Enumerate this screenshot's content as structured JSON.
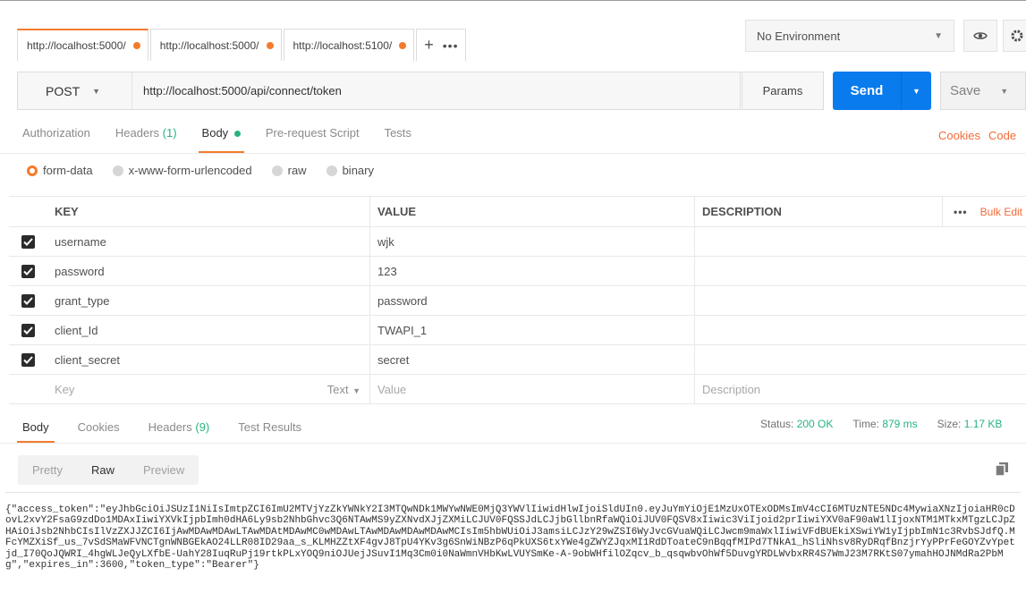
{
  "tabs": [
    {
      "label": "http://localhost:5000/"
    },
    {
      "label": "http://localhost:5000/"
    },
    {
      "label": "http://localhost:5100/"
    }
  ],
  "environment": {
    "selected": "No Environment"
  },
  "request": {
    "method": "POST",
    "url": "http://localhost:5000/api/connect/token",
    "params_label": "Params",
    "send_label": "Send",
    "save_label": "Save"
  },
  "request_tabs": {
    "authorization": "Authorization",
    "headers": "Headers",
    "headers_count": "(1)",
    "body": "Body",
    "prerequest": "Pre-request Script",
    "tests": "Tests",
    "cookies": "Cookies",
    "code": "Code"
  },
  "body_types": {
    "form_data": "form-data",
    "urlencoded": "x-www-form-urlencoded",
    "raw": "raw",
    "binary": "binary"
  },
  "table": {
    "headers": {
      "key": "KEY",
      "value": "VALUE",
      "description": "DESCRIPTION",
      "bulk_edit": "Bulk Edit"
    },
    "rows": [
      {
        "key": "username",
        "value": "wjk"
      },
      {
        "key": "password",
        "value": "123"
      },
      {
        "key": "grant_type",
        "value": "password"
      },
      {
        "key": "client_Id",
        "value": "TWAPI_1"
      },
      {
        "key": "client_secret",
        "value": "secret"
      }
    ],
    "new_row": {
      "key_placeholder": "Key",
      "type": "Text",
      "value_placeholder": "Value",
      "description_placeholder": "Description"
    }
  },
  "response": {
    "tabs": {
      "body": "Body",
      "cookies": "Cookies",
      "headers": "Headers",
      "headers_count": "(9)",
      "test_results": "Test Results"
    },
    "status_label": "Status:",
    "status_value": "200 OK",
    "time_label": "Time:",
    "time_value": "879 ms",
    "size_label": "Size:",
    "size_value": "1.17 KB",
    "view_modes": {
      "pretty": "Pretty",
      "raw": "Raw",
      "preview": "Preview"
    },
    "body_text": "{\"access_token\":\"eyJhbGciOiJSUzI1NiIsImtpZCI6ImU2MTVjYzZkYWNkY2I3MTQwNDk1MWYwNWE0MjQ3YWVlIiwidHlwIjoiSldUIn0.eyJuYmYiOjE1MzUxOTExODMsImV4cCI6MTUzNTE5NDc4MywiaXNzIjoiaHR0cDovL2xvY2FsaG9zdDo1MDAxIiwiYXVkIjpbImh0dHA6Ly9sb2NhbGhvc3Q6NTAwMS9yZXNvdXJjZXMiLCJUV0FQSSJdLCJjbGllbnRfaWQiOiJUV0FQSV8xIiwic3ViIjoid2prIiwiYXV0aF90aW1lIjoxNTM1MTkxMTgzLCJpZHAiOiJsb2NhbCIsIlVzZXJJZCI6IjAwMDAwMDAwLTAwMDAtMDAwMC0wMDAwLTAwMDAwMDAwMDAwMCIsIm5hbWUiOiJ3amsiLCJzY29wZSI6WyJvcGVuaWQiLCJwcm9maWxlIiwiVFdBUEkiXSwiYW1yIjpbImN1c3RvbSJdfQ.MFcYMZXiSf_us_7vSdSMaWFVNCTgnWNBGEkAO24LLR08ID29aa_s_KLMHZZtXF4gvJ8TpU4YKv3g6SnWiNBzP6qPkUXS6txYWe4gZWYZJqxMI1RdDToateC9nBqqfMIPd7TNkA1_hSliNhsv8RyDRqfBnzjrYyPPrFeGOYZvYpetjd_I70QoJQWRI_4hgWLJeQyLXfbE-UahY28IuqRuPj19rtkPLxYOQ9niOJUejJSuvI1Mq3Cm0i0NaWmnVHbKwLVUYSmKe-A-9obWHfilOZqcv_b_qsqwbvOhWf5DuvgYRDLWvbxRR4S7WmJ23M7RKtS07ymahHOJNMdRa2PbMg\",\"expires_in\":3600,\"token_type\":\"Bearer\"}"
  }
}
